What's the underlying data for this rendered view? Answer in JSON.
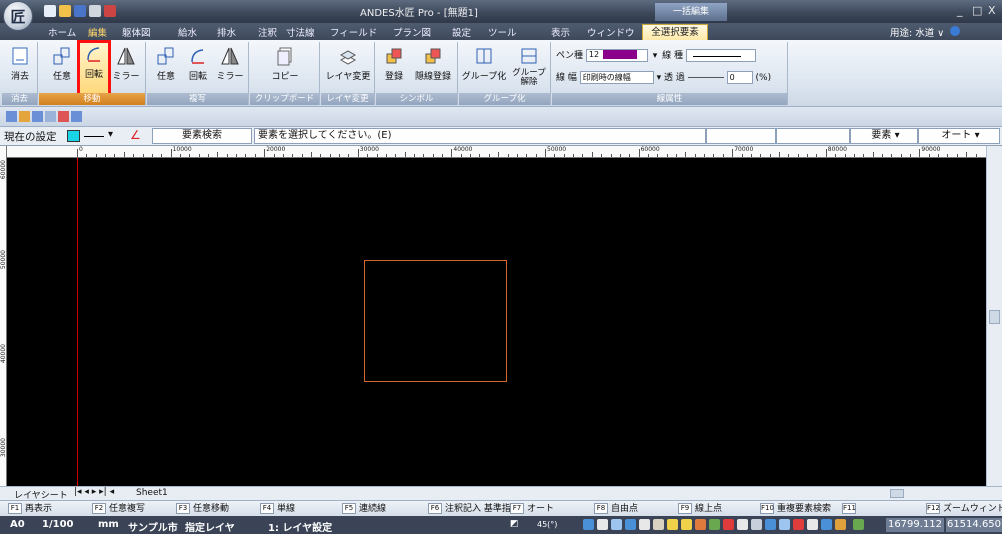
{
  "app": {
    "title": "ANDES水匠 Pro - [無題1]",
    "logo_char": "匠",
    "context_label": "一括編集"
  },
  "window_controls": {
    "minimize": "_",
    "restore": "□",
    "close": "X"
  },
  "tabs": [
    "ホーム",
    "編集",
    "躯体図",
    "給水",
    "排水",
    "注釈",
    "寸法線",
    "フィールド",
    "プラン図",
    "設定",
    "ツール",
    "表示",
    "ウィンドウ"
  ],
  "active_tab": "全選択要素",
  "usage": "用途: 水道 ∨",
  "ribbon": {
    "groups": {
      "erase": {
        "label": "消去",
        "buttons": [
          "消去"
        ]
      },
      "move": {
        "label": "移動",
        "buttons": [
          "任意",
          "回転",
          "ミラー"
        ]
      },
      "copy": {
        "label": "複写",
        "buttons": [
          "任意",
          "回転",
          "ミラー"
        ]
      },
      "clipboard": {
        "label": "クリップボード",
        "buttons": [
          "コピー"
        ]
      },
      "layer": {
        "label": "レイヤ変更",
        "buttons": [
          "レイヤ変更"
        ]
      },
      "symbol": {
        "label": "シンボル",
        "buttons": [
          "登録",
          "隠線登録"
        ]
      },
      "group": {
        "label": "グループ化",
        "buttons": [
          "グループ化",
          "グループ\n解除"
        ]
      },
      "lineprops": {
        "label": "線属性",
        "pen_label": "ペン種",
        "pen_value": "12",
        "pen_color": "#8b008b",
        "linetype_label": "線 種",
        "linewidth_label": "線 幅",
        "linewidth_value": "印刷時の線幅",
        "transparency_label": "透 過",
        "transparency_value": "0",
        "unit": "(%)"
      }
    }
  },
  "setting_bar": {
    "current_setting": "現在の設定",
    "swatch_color": "#19d3e6",
    "search_label": "要素検索",
    "prompt": "要素を選択してください。(E)",
    "element_label": "要素",
    "auto_label": "オート"
  },
  "ruler": {
    "h_labels": [
      "0",
      "10000",
      "20000",
      "30000",
      "40000",
      "50000",
      "60000",
      "70000",
      "80000",
      "90000"
    ],
    "v_labels": [
      "60000",
      "50000",
      "40000",
      "30000"
    ]
  },
  "sheet_bar": {
    "layer_sheet": "レイヤシート",
    "sheet_name": "Sheet1"
  },
  "fkeys": [
    {
      "key": "F1",
      "label": "再表示"
    },
    {
      "key": "F2",
      "label": "任意複写"
    },
    {
      "key": "F3",
      "label": "任意移動"
    },
    {
      "key": "F4",
      "label": "単線"
    },
    {
      "key": "F5",
      "label": "連続線"
    },
    {
      "key": "F6",
      "label": "注釈記入 基準指定"
    },
    {
      "key": "F7",
      "label": "オート"
    },
    {
      "key": "F8",
      "label": "自由点"
    },
    {
      "key": "F9",
      "label": "線上点"
    },
    {
      "key": "F10",
      "label": "重複要素検索"
    },
    {
      "key": "F11",
      "label": ""
    },
    {
      "key": "F12",
      "label": "ズームウィンドウ"
    }
  ],
  "status": {
    "paper": "A0",
    "scale": "1/100",
    "unit": "mm",
    "city": "サンプル市",
    "layer_mode": "指定レイヤ",
    "layer": "1: レイヤ設定",
    "angle": "45(°)",
    "x": "16799.112",
    "y": "61514.650"
  }
}
